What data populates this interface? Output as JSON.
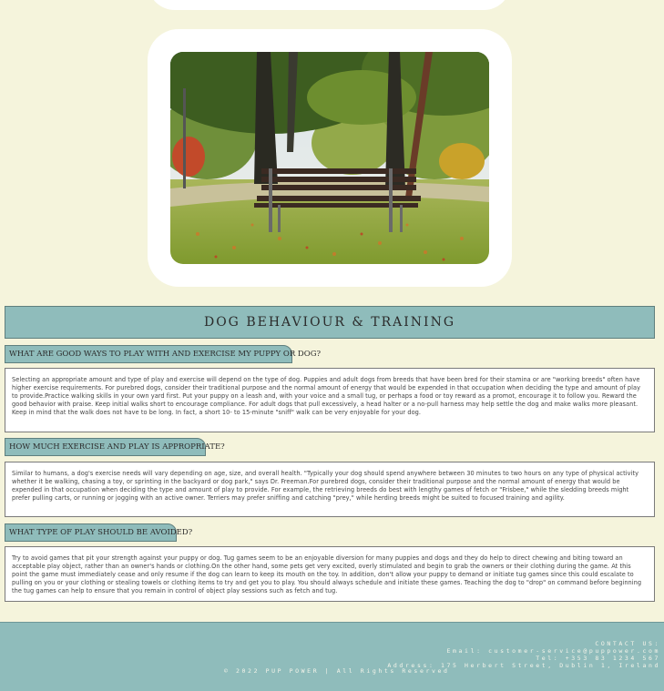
{
  "page": {
    "heading": "DOG BEHAVIOUR & TRAINING"
  },
  "hero_image": {
    "icon": "park-bench-photo"
  },
  "faq": [
    {
      "question": "WHAT ARE GOOD WAYS TO PLAY WITH AND EXERCISE MY PUPPY OR DOG?",
      "answer": "Selecting an appropriate amount and type of play and exercise will depend on the type of dog. Puppies and adult dogs from breeds that have been bred for their stamina or are \"working breeds\" often have higher exercise requirements. For purebred dogs, consider their traditional purpose and the normal amount of energy that would be expended in that occupation when deciding the type and amount of play to provide.Practice walking skills in your own yard first. Put your puppy on a leash and, with your voice and a small tug, or perhaps a food or toy reward as a promot, encourage it to follow you. Reward the good behavior with praise. Keep initial walks short to encourage compliance. For adult dogs that pull excessively, a head halter or a no-pull harness may help settle the dog and make walks more pleasant. Keep in mind that the walk does not have to be long. In fact, a short 10- to 15-minute \"sniff\" walk can be very enjoyable for your dog."
    },
    {
      "question": "HOW MUCH EXERCISE AND PLAY IS APPROPRIATE?",
      "answer": "Similar to humans, a dog's exercise needs will vary depending on age, size, and overall health. \"Typically your dog should spend anywhere between 30 minutes to two hours on any type of physical activity whether it be walking, chasing a toy, or sprinting in the backyard or dog park,\" says Dr. Freeman.For purebred dogs, consider their traditional purpose and the normal amount of energy that would be expended in that occupation when deciding the type and amount of play to provide. For example, the retrieving breeds do best with lengthy games of fetch or \"Frisbee,\" while the sledding breeds might prefer pulling carts, or running or jogging with an active owner. Terriers may prefer sniffing and catching \"prey,\" while herding breeds might be suited to focused training and agility."
    },
    {
      "question": "WHAT TYPE OF PLAY SHOULD BE AVOIDED?",
      "answer": "Try to avoid games that pit your strength against your puppy or dog. Tug games seem to be an enjoyable diversion for many puppies and dogs and they do help to direct chewing and biting toward an acceptable play object, rather than an owner's hands or clothing.On the other hand, some pets get very excited, overly stimulated and begin to grab the owners or their clothing during the game. At this point the game must immediately cease and only resume if the dog can learn to keep its mouth on the toy. In addition, don't allow your puppy to demand or initiate tug games since this could escalate to pulling on you or your clothing or stealing towels or clothing items to try and get you to play. You should always schedule and initiate these games. Teaching the dog to \"drop\" on command before beginning the tug games can help to ensure that you remain in control of object play sessions such as fetch and tug."
    }
  ],
  "footer": {
    "contact_heading": "CONTACT US:",
    "email": "Email: customer-service@puppower.com",
    "tel": "Tel: +353 83 1234 567",
    "address": "Address: 175 Herbert Street, Dublin 1, Ireland",
    "copyright": "© 2022 PUP POWER | All Rights Reserved"
  }
}
